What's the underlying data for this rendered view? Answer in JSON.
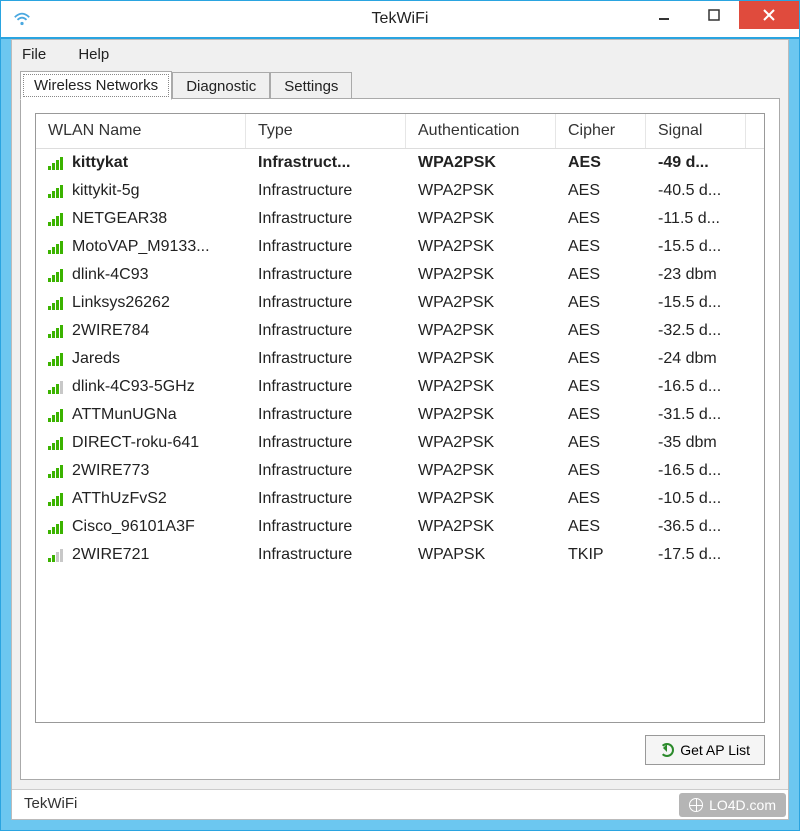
{
  "window": {
    "title": "TekWiFi"
  },
  "menu": {
    "file": "File",
    "help": "Help"
  },
  "tabs": [
    {
      "label": "Wireless Networks",
      "active": true
    },
    {
      "label": "Diagnostic",
      "active": false
    },
    {
      "label": "Settings",
      "active": false
    }
  ],
  "columns": {
    "name": "WLAN Name",
    "type": "Type",
    "auth": "Authentication",
    "cipher": "Cipher",
    "signal": "Signal"
  },
  "networks": [
    {
      "name": "kittykat",
      "type": "Infrastruct...",
      "auth": "WPA2PSK",
      "cipher": "AES",
      "signal": "-49 d...",
      "bars": 4,
      "bold": true
    },
    {
      "name": "kittykit-5g",
      "type": "Infrastructure",
      "auth": "WPA2PSK",
      "cipher": "AES",
      "signal": "-40.5 d...",
      "bars": 4,
      "bold": false
    },
    {
      "name": "NETGEAR38",
      "type": "Infrastructure",
      "auth": "WPA2PSK",
      "cipher": "AES",
      "signal": "-11.5 d...",
      "bars": 4,
      "bold": false
    },
    {
      "name": "MotoVAP_M9133...",
      "type": "Infrastructure",
      "auth": "WPA2PSK",
      "cipher": "AES",
      "signal": "-15.5 d...",
      "bars": 4,
      "bold": false
    },
    {
      "name": "dlink-4C93",
      "type": "Infrastructure",
      "auth": "WPA2PSK",
      "cipher": "AES",
      "signal": "-23 dbm",
      "bars": 4,
      "bold": false
    },
    {
      "name": "Linksys26262",
      "type": "Infrastructure",
      "auth": "WPA2PSK",
      "cipher": "AES",
      "signal": "-15.5 d...",
      "bars": 4,
      "bold": false
    },
    {
      "name": "2WIRE784",
      "type": "Infrastructure",
      "auth": "WPA2PSK",
      "cipher": "AES",
      "signal": "-32.5 d...",
      "bars": 4,
      "bold": false
    },
    {
      "name": "Jareds",
      "type": "Infrastructure",
      "auth": "WPA2PSK",
      "cipher": "AES",
      "signal": "-24 dbm",
      "bars": 4,
      "bold": false
    },
    {
      "name": "dlink-4C93-5GHz",
      "type": "Infrastructure",
      "auth": "WPA2PSK",
      "cipher": "AES",
      "signal": "-16.5 d...",
      "bars": 3,
      "bold": false
    },
    {
      "name": "ATTMunUGNa",
      "type": "Infrastructure",
      "auth": "WPA2PSK",
      "cipher": "AES",
      "signal": "-31.5 d...",
      "bars": 4,
      "bold": false
    },
    {
      "name": "DIRECT-roku-641",
      "type": "Infrastructure",
      "auth": "WPA2PSK",
      "cipher": "AES",
      "signal": "-35 dbm",
      "bars": 4,
      "bold": false
    },
    {
      "name": "2WIRE773",
      "type": "Infrastructure",
      "auth": "WPA2PSK",
      "cipher": "AES",
      "signal": "-16.5 d...",
      "bars": 4,
      "bold": false
    },
    {
      "name": "ATThUzFvS2",
      "type": "Infrastructure",
      "auth": "WPA2PSK",
      "cipher": "AES",
      "signal": "-10.5 d...",
      "bars": 4,
      "bold": false
    },
    {
      "name": "Cisco_96101A3F",
      "type": "Infrastructure",
      "auth": "WPA2PSK",
      "cipher": "AES",
      "signal": "-36.5 d...",
      "bars": 4,
      "bold": false
    },
    {
      "name": "2WIRE721",
      "type": "Infrastructure",
      "auth": "WPAPSK",
      "cipher": "TKIP",
      "signal": "-17.5 d...",
      "bars": 2,
      "bold": false
    }
  ],
  "buttons": {
    "get_ap_list": "Get AP List"
  },
  "statusbar": "TekWiFi",
  "watermark": "LO4D.com"
}
